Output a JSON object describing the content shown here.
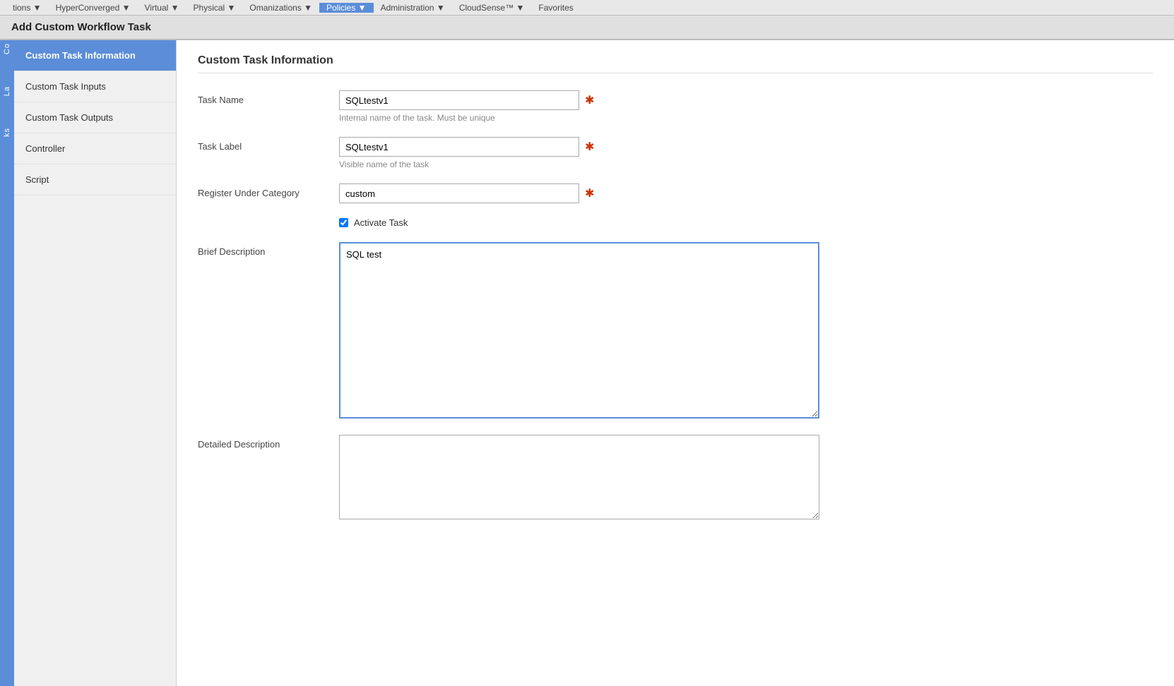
{
  "topnav": {
    "items": [
      {
        "label": "tions ▼",
        "active": false
      },
      {
        "label": "HyperConverged ▼",
        "active": false
      },
      {
        "label": "Virtual ▼",
        "active": false
      },
      {
        "label": "Physical ▼",
        "active": false
      },
      {
        "label": "Omanizations ▼",
        "active": false
      },
      {
        "label": "Policies ▼",
        "active": true
      },
      {
        "label": "Administration ▼",
        "active": false
      },
      {
        "label": "CloudSense™ ▼",
        "active": false
      },
      {
        "label": "Favorites",
        "active": false
      }
    ]
  },
  "dialog": {
    "title": "Add Custom Workflow Task"
  },
  "sidebar": {
    "items": [
      {
        "label": "Custom Task Information",
        "active": true
      },
      {
        "label": "Custom Task Inputs",
        "active": false
      },
      {
        "label": "Custom Task Outputs",
        "active": false
      },
      {
        "label": "Controller",
        "active": false
      },
      {
        "label": "Script",
        "active": false
      }
    ]
  },
  "content": {
    "title": "Custom Task Information",
    "fields": {
      "taskName": {
        "label": "Task Name",
        "value": "SQLtestv1",
        "hint": "Internal name of the task. Must be unique",
        "required": true
      },
      "taskLabel": {
        "label": "Task Label",
        "value": "SQLtestv1",
        "hint": "Visible name of the task",
        "required": true
      },
      "registerCategory": {
        "label": "Register Under Category",
        "value": "custom",
        "required": true
      },
      "activateTask": {
        "label": "Activate Task",
        "checked": true
      },
      "briefDescription": {
        "label": "Brief Description",
        "value": "SQL test"
      },
      "detailedDescription": {
        "label": "Detailed Description",
        "value": ""
      }
    }
  },
  "leftstrip": {
    "labels": [
      "Co",
      "La",
      "ks"
    ]
  }
}
